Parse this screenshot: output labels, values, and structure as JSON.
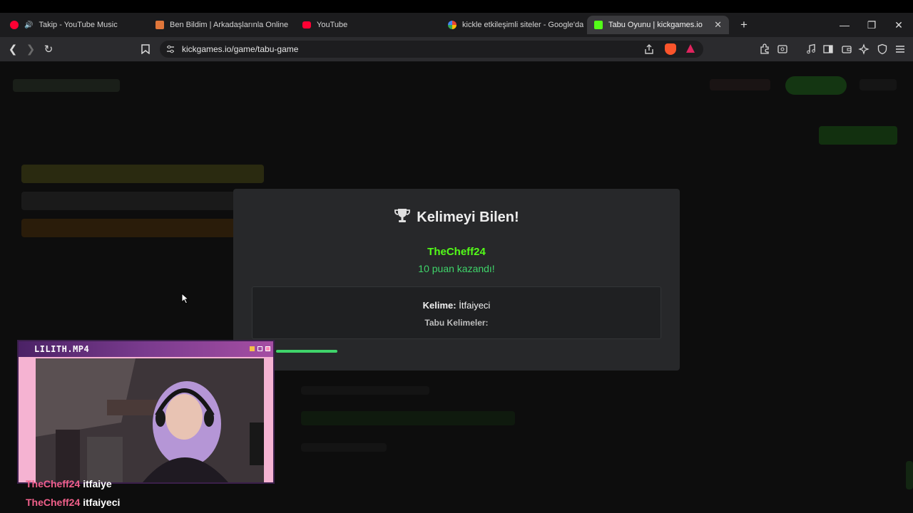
{
  "browser": {
    "tabs": [
      {
        "label": "Takip - YouTube Music",
        "icon": "youtube-music-icon",
        "color": "#ff0033"
      },
      {
        "label": "Ben Bildim | Arkadaşlarınla Online Bil",
        "icon": "quiz-site-icon",
        "color": "#e0763a"
      },
      {
        "label": "YouTube",
        "icon": "youtube-icon",
        "color": "#ff0033"
      },
      {
        "label": "kickle etkileşimli siteler - Google'da A",
        "icon": "google-icon",
        "color": "#4285f4"
      },
      {
        "label": "Tabu Oyunu | kickgames.io",
        "icon": "kickgames-icon",
        "color": "#53fc18",
        "active": true
      }
    ],
    "url": "kickgames.io/game/tabu-game"
  },
  "modal": {
    "title": "Kelimeyi Bilen!",
    "title_icon": "trophy-icon",
    "winner": "TheCheff24",
    "points_text": "10 puan kazandı!",
    "word_label": "Kelime:",
    "word_value": "İtfaiyeci",
    "taboo_label": "Tabu Kelimeler:",
    "timer_progress_fraction": 0.17
  },
  "webcam": {
    "title": "LILITH.MP4"
  },
  "chat": [
    {
      "user": "TheCheff24",
      "message": "itfaiye"
    },
    {
      "user": "TheCheff24",
      "message": "itfaiyeci"
    }
  ],
  "colors": {
    "accent_green": "#53fc18",
    "points_green": "#3fd46a",
    "chat_user": "#f0608a"
  }
}
